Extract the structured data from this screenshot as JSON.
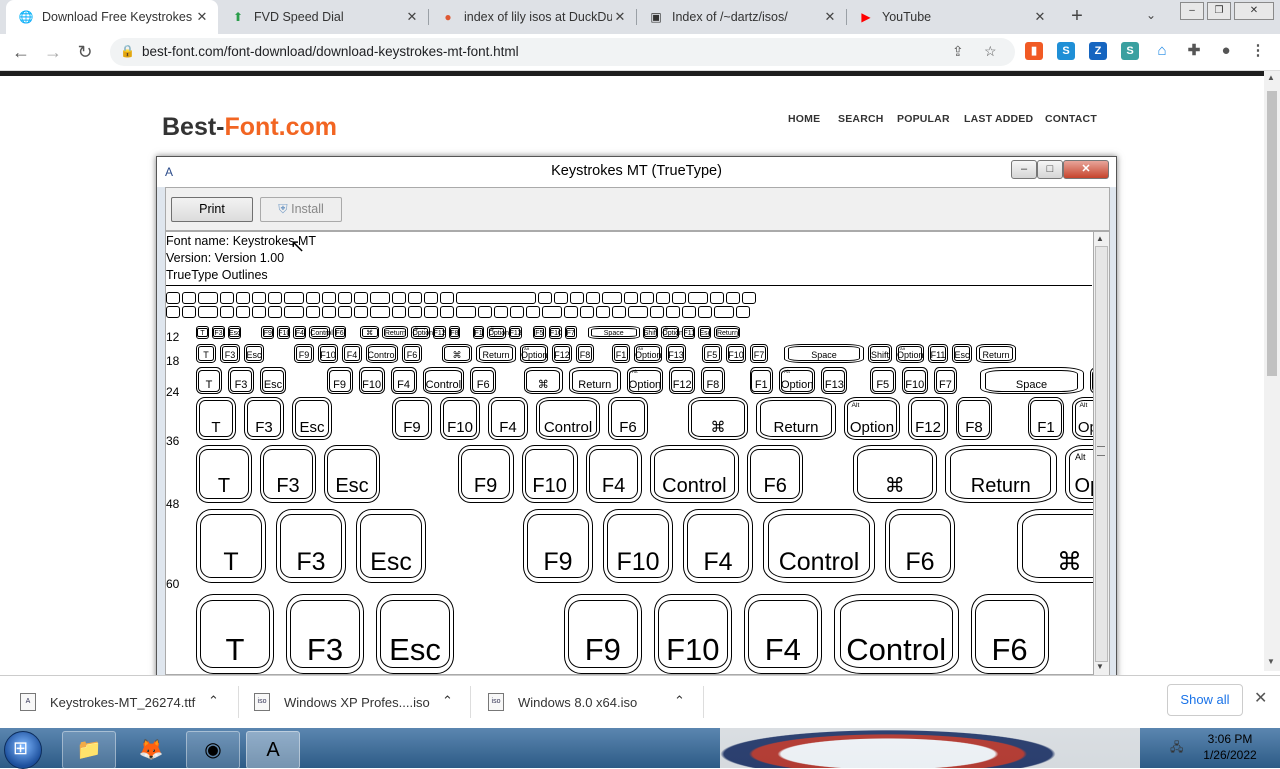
{
  "browser": {
    "tabs": [
      {
        "title": "Download Free Keystrokes MT",
        "icon": "globe-icon",
        "active": true
      },
      {
        "title": "FVD Speed Dial",
        "icon": "speed-dial-icon",
        "active": false
      },
      {
        "title": "index of lily isos at DuckDuckGo",
        "icon": "duckduckgo-icon",
        "active": false
      },
      {
        "title": "Index of /~dartz/isos/",
        "icon": "page-icon",
        "active": false
      },
      {
        "title": "YouTube",
        "icon": "youtube-icon",
        "active": false
      }
    ],
    "url": "best-font.com/font-download/download-keystrokes-mt-font.html"
  },
  "site": {
    "logo_a": "Best-",
    "logo_b": "Font.com",
    "nav": [
      "HOME",
      "SEARCH",
      "POPULAR",
      "LAST ADDED",
      "CONTACT"
    ]
  },
  "viewer": {
    "title": "Keystrokes MT (TrueType)",
    "print_label": "Print",
    "install_label": "Install",
    "font_name": "Font name: Keystrokes MT",
    "version": "Version: Version 1.00",
    "outline": "TrueType Outlines",
    "sizes": [
      "12",
      "18",
      "24",
      "36",
      "48",
      "60"
    ],
    "keys": [
      "T",
      "F3",
      "Esc",
      "F9",
      "F10",
      "F4",
      "Control",
      "F6",
      "⌘",
      "Return",
      "Option",
      "F12",
      "F8",
      "F1",
      "Option",
      "F13",
      "F5",
      "F10",
      "F7",
      "Space",
      "Shift",
      "Option",
      "F11",
      "Esc",
      "Return"
    ],
    "alt_label": "Alt"
  },
  "downloads": {
    "items": [
      {
        "name": "Keystrokes-MT_26274.ttf"
      },
      {
        "name": "Windows XP Profes....iso"
      },
      {
        "name": "Windows 8.0 x64.iso"
      }
    ],
    "show_all": "Show all"
  },
  "taskbar": {
    "time": "3:06 PM",
    "date": "1/26/2022"
  },
  "colors": {
    "brand_orange": "#f26522",
    "accent": "#1a73e8"
  }
}
